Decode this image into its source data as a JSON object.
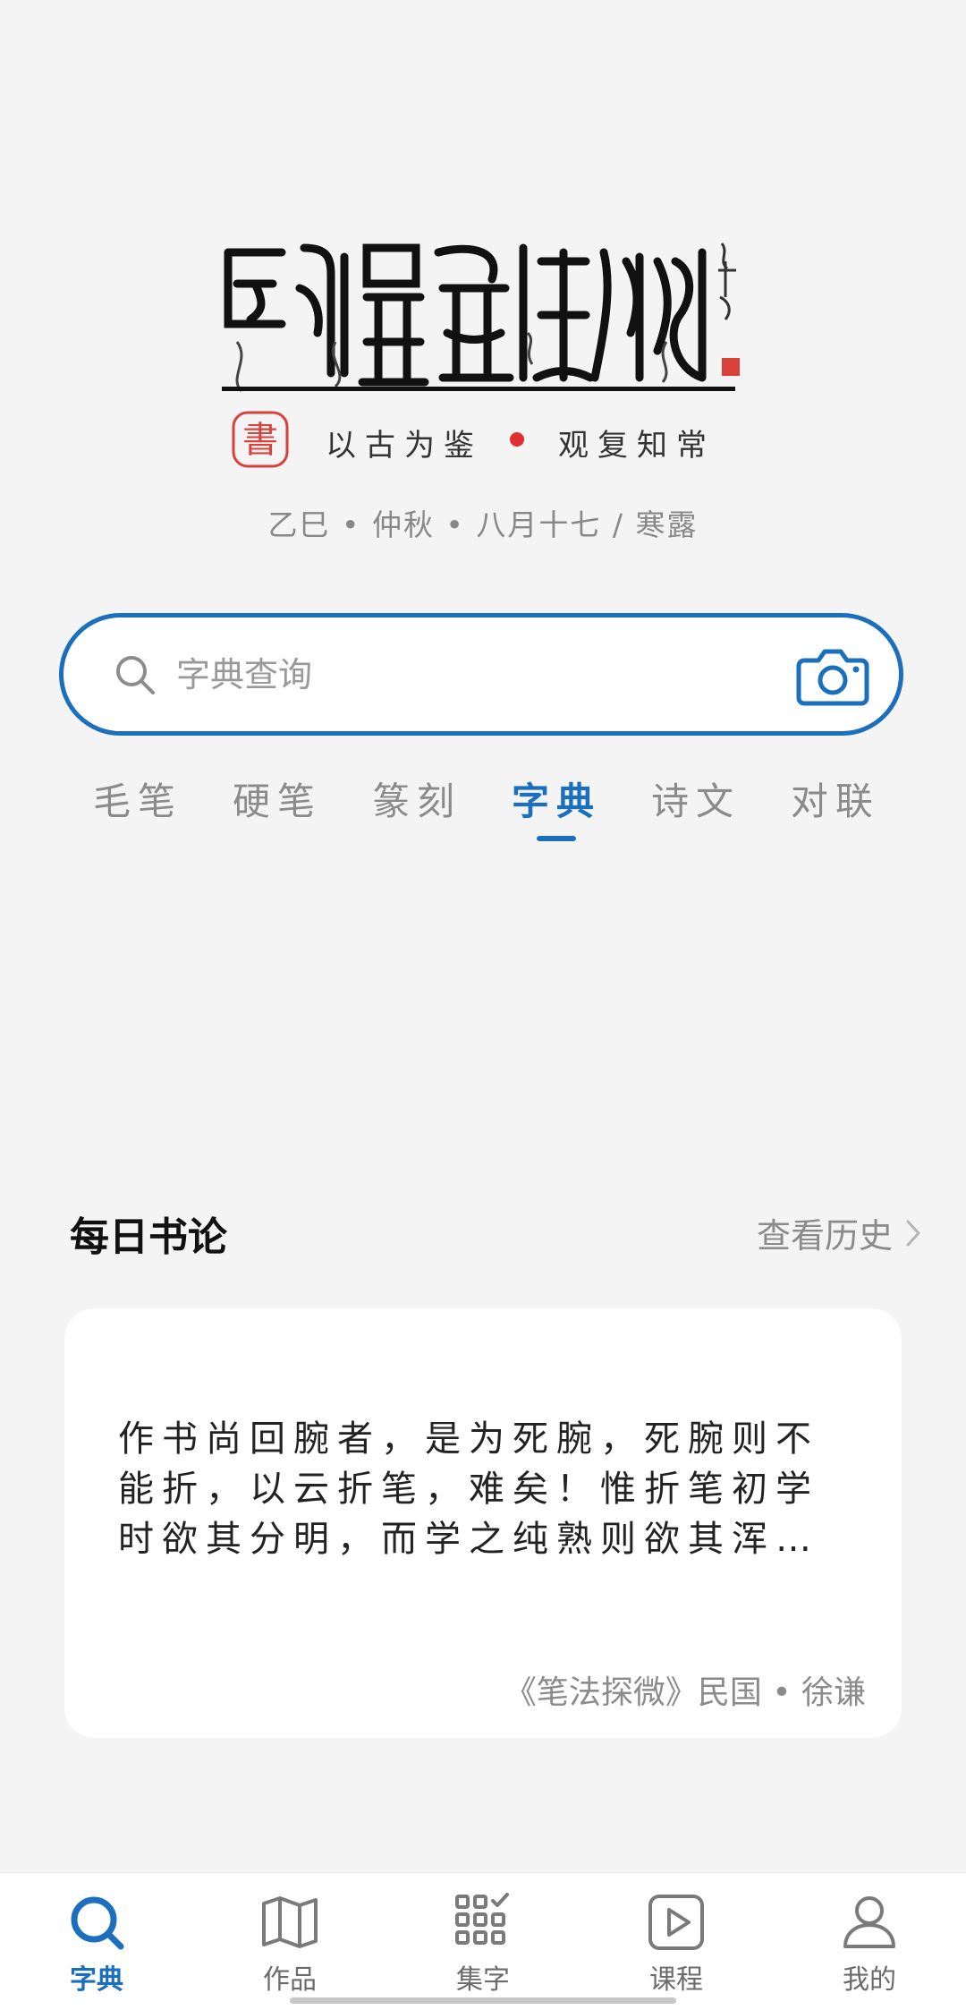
{
  "header": {
    "logo_name": "calligraphy-logo",
    "seal_char": "書",
    "motto_left": "以古为鉴",
    "motto_right": "观复知常",
    "date_line": "乙巳 • 仲秋 • 八月十七 / 寒露"
  },
  "search": {
    "placeholder": "字典查询",
    "value": ""
  },
  "tabs": [
    {
      "label": "毛笔",
      "active": false
    },
    {
      "label": "硬笔",
      "active": false
    },
    {
      "label": "篆刻",
      "active": false
    },
    {
      "label": "字典",
      "active": true
    },
    {
      "label": "诗文",
      "active": false
    },
    {
      "label": "对联",
      "active": false
    }
  ],
  "daily": {
    "title": "每日书论",
    "history_label": "查看历史",
    "quote": "作书尚回腕者，是为死腕，死腕则不能折，以云折笔，难矣！惟折笔初学时欲其分明，而学之纯熟则欲其浑成，使…",
    "source": "《笔法探微》民国 • 徐谦"
  },
  "bottom_nav": [
    {
      "label": "字典",
      "icon": "search-icon",
      "active": true
    },
    {
      "label": "作品",
      "icon": "map-icon",
      "active": false
    },
    {
      "label": "集字",
      "icon": "grid-check-icon",
      "active": false
    },
    {
      "label": "课程",
      "icon": "play-icon",
      "active": false
    },
    {
      "label": "我的",
      "icon": "profile-icon",
      "active": false
    }
  ],
  "colors": {
    "accent": "#1b6fbd",
    "dot": "#e0302f",
    "seal": "#d9413a",
    "muted": "#8b8b8b"
  }
}
